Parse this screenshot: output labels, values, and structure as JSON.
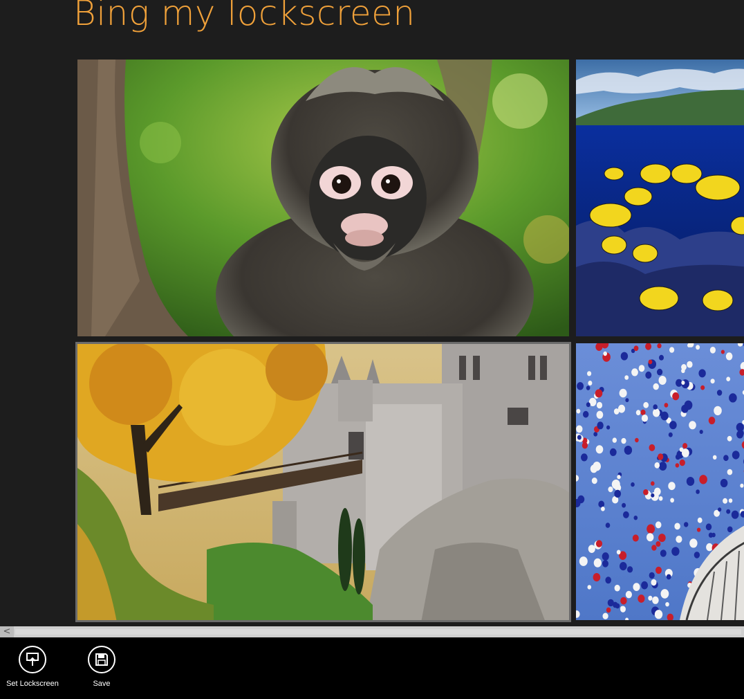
{
  "header": {
    "title": "Bing my lockscreen"
  },
  "gallery": {
    "tiles": [
      {
        "icon": "monkey-image",
        "selected": false
      },
      {
        "icon": "fish-reef-image",
        "selected": false
      },
      {
        "icon": "castle-image",
        "selected": true
      },
      {
        "icon": "balloons-image",
        "selected": false
      }
    ]
  },
  "scrollbar": {
    "left_arrow": "<"
  },
  "appbar": {
    "set_lockscreen_label": "Set Lockscreen",
    "save_label": "Save"
  },
  "colors": {
    "title_accent": "#f0a13a",
    "background": "#1d1d1d",
    "appbar": "#000000"
  }
}
